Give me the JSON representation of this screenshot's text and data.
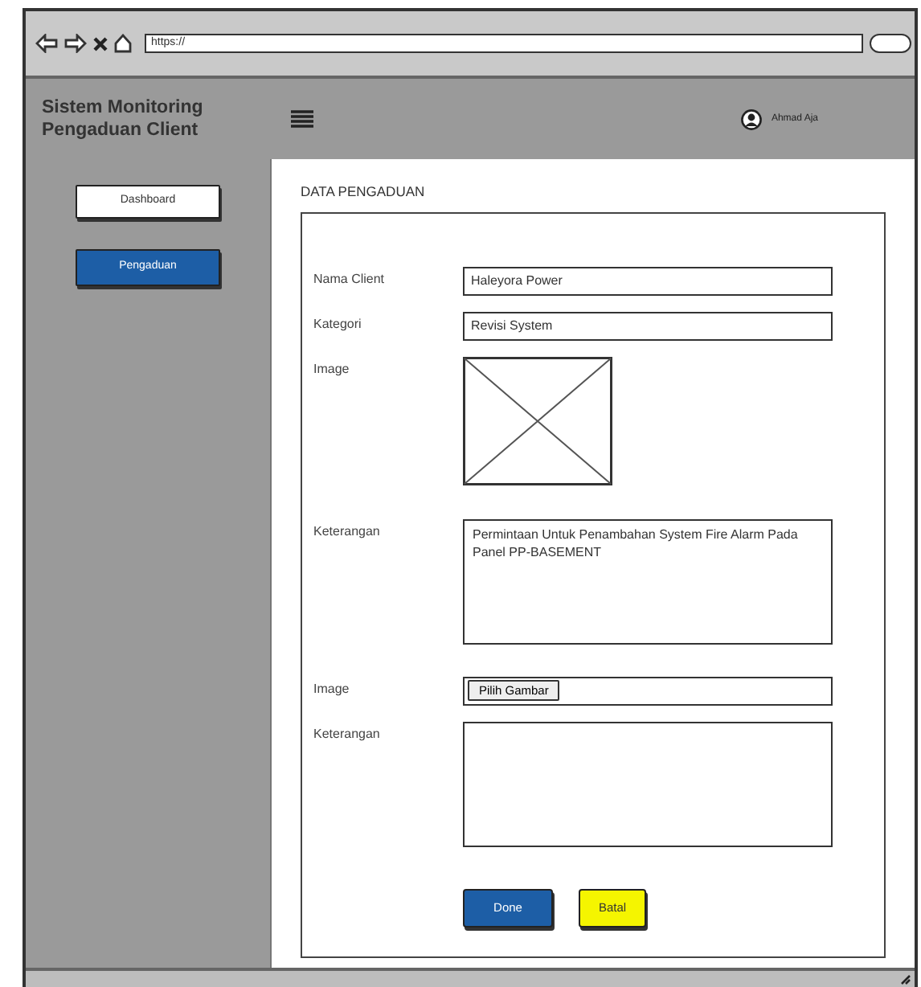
{
  "browser": {
    "url": "https://"
  },
  "header": {
    "title": "Sistem Monitoring Pengaduan Client",
    "user": "Ahmad Aja"
  },
  "sidebar": {
    "items": [
      {
        "label": "Dashboard",
        "selected": false
      },
      {
        "label": "Pengaduan",
        "selected": true
      }
    ]
  },
  "form": {
    "title": "DATA PENGADUAN",
    "fields": [
      {
        "kind": "text",
        "label": "Nama Client",
        "value": "Haleyora Power"
      },
      {
        "kind": "text",
        "label": "Kategori",
        "value": "Revisi System"
      },
      {
        "kind": "image",
        "label": "Image"
      },
      {
        "kind": "textarea",
        "label": "Keterangan",
        "value": "Permintaan Untuk Penambahan System Fire Alarm Pada Panel PP-BASEMENT"
      },
      {
        "kind": "file",
        "label": "Image",
        "button": "Pilih Gambar"
      },
      {
        "kind": "textarea",
        "label": "Keterangan"
      }
    ],
    "buttons": [
      {
        "label": "Done",
        "kind": "primary"
      },
      {
        "label": "Batal",
        "kind": "warning"
      }
    ]
  }
}
